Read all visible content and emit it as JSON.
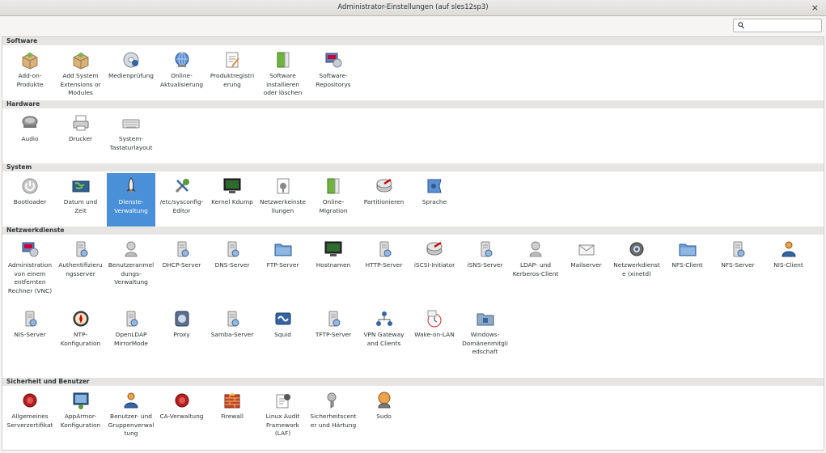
{
  "window": {
    "title": "Administrator-Einstellungen (auf sles12sp3)",
    "close_glyph": "×"
  },
  "search": {
    "value": "",
    "placeholder": ""
  },
  "sections": [
    {
      "name": "Software",
      "items": [
        {
          "label": "Add-on-Produkte",
          "icon": "addon-box-icon"
        },
        {
          "label": "Add System Extensions or Modules",
          "icon": "extension-box-icon"
        },
        {
          "label": "Medienprüfung",
          "icon": "media-check-icon"
        },
        {
          "label": "Online-Aktualisierung",
          "icon": "online-update-icon"
        },
        {
          "label": "Produktregistrierung",
          "icon": "registration-icon"
        },
        {
          "label": "Software installieren oder löschen",
          "icon": "software-install-icon"
        },
        {
          "label": "Software-Repositorys",
          "icon": "repository-icon"
        }
      ]
    },
    {
      "name": "Hardware",
      "items": [
        {
          "label": "Audio",
          "icon": "audio-icon"
        },
        {
          "label": "Drucker",
          "icon": "printer-icon"
        },
        {
          "label": "System-Tastaturlayout",
          "icon": "keyboard-icon"
        }
      ]
    },
    {
      "name": "System",
      "items": [
        {
          "label": "Bootloader",
          "icon": "power-icon"
        },
        {
          "label": "Datum und Zeit",
          "icon": "date-time-icon"
        },
        {
          "label": "Dienste-Verwaltung",
          "icon": "services-icon",
          "selected": true
        },
        {
          "label": "/etc/sysconfig-Editor",
          "icon": "sysconfig-icon"
        },
        {
          "label": "Kernel Kdump",
          "icon": "kdump-icon"
        },
        {
          "label": "Netzwerkeinstellungen",
          "icon": "network-settings-icon"
        },
        {
          "label": "Online-Migration",
          "icon": "migration-icon"
        },
        {
          "label": "Partitionieren",
          "icon": "partitioner-icon"
        },
        {
          "label": "Sprache",
          "icon": "language-icon"
        }
      ]
    },
    {
      "name": "Netzwerkdienste",
      "items": [
        {
          "label": "Administration von einem entfernten Rechner (VNC)",
          "icon": "vnc-icon"
        },
        {
          "label": "Authentifizierungsserver",
          "icon": "auth-server-icon"
        },
        {
          "label": "Benutzeranmeldungs-Verwaltung",
          "icon": "user-login-icon"
        },
        {
          "label": "DHCP-Server",
          "icon": "dhcp-server-icon"
        },
        {
          "label": "DNS-Server",
          "icon": "dns-server-icon"
        },
        {
          "label": "FTP-Server",
          "icon": "ftp-server-icon"
        },
        {
          "label": "Hostnamen",
          "icon": "hostname-icon"
        },
        {
          "label": "HTTP-Server",
          "icon": "http-server-icon"
        },
        {
          "label": "iSCSI-Initiator",
          "icon": "iscsi-initiator-icon"
        },
        {
          "label": "iSNS-Server",
          "icon": "isns-server-icon"
        },
        {
          "label": "LDAP- und Kerberos-Client",
          "icon": "ldap-client-icon"
        },
        {
          "label": "Mailserver",
          "icon": "mail-server-icon"
        },
        {
          "label": "Netzwerkdienste (xinetd)",
          "icon": "xinetd-icon"
        },
        {
          "label": "NFS-Client",
          "icon": "nfs-client-icon"
        },
        {
          "label": "NFS-Server",
          "icon": "nfs-server-icon"
        },
        {
          "label": "NIS-Client",
          "icon": "nis-client-icon"
        },
        {
          "label": "NIS-Server",
          "icon": "nis-server-icon"
        },
        {
          "label": "NTP-Konfiguration",
          "icon": "ntp-icon"
        },
        {
          "label": "OpenLDAP MirrorMode",
          "icon": "openldap-icon"
        },
        {
          "label": "Proxy",
          "icon": "proxy-icon"
        },
        {
          "label": "Samba-Server",
          "icon": "samba-server-icon"
        },
        {
          "label": "Squid",
          "icon": "squid-icon"
        },
        {
          "label": "TFTP-Server",
          "icon": "tftp-server-icon"
        },
        {
          "label": "VPN Gateway and Clients",
          "icon": "vpn-icon"
        },
        {
          "label": "Wake-on-LAN",
          "icon": "wake-on-lan-icon"
        },
        {
          "label": "Windows-Domänenmitgliedschaft",
          "icon": "windows-domain-icon"
        }
      ]
    },
    {
      "name": "Sicherheit und Benutzer",
      "items": [
        {
          "label": "Allgemeines Serverzertifikat",
          "icon": "certificate-icon"
        },
        {
          "label": "AppArmor-Konfiguration",
          "icon": "apparmor-icon"
        },
        {
          "label": "Benutzer- und Gruppenverwaltung",
          "icon": "users-groups-icon"
        },
        {
          "label": "CA-Verwaltung",
          "icon": "ca-management-icon"
        },
        {
          "label": "Firewall",
          "icon": "firewall-icon"
        },
        {
          "label": "Linux Audit Framework (LAF)",
          "icon": "audit-icon"
        },
        {
          "label": "Sicherheitscenter und Härtung",
          "icon": "security-center-icon"
        },
        {
          "label": "Sudo",
          "icon": "sudo-icon"
        }
      ]
    }
  ]
}
